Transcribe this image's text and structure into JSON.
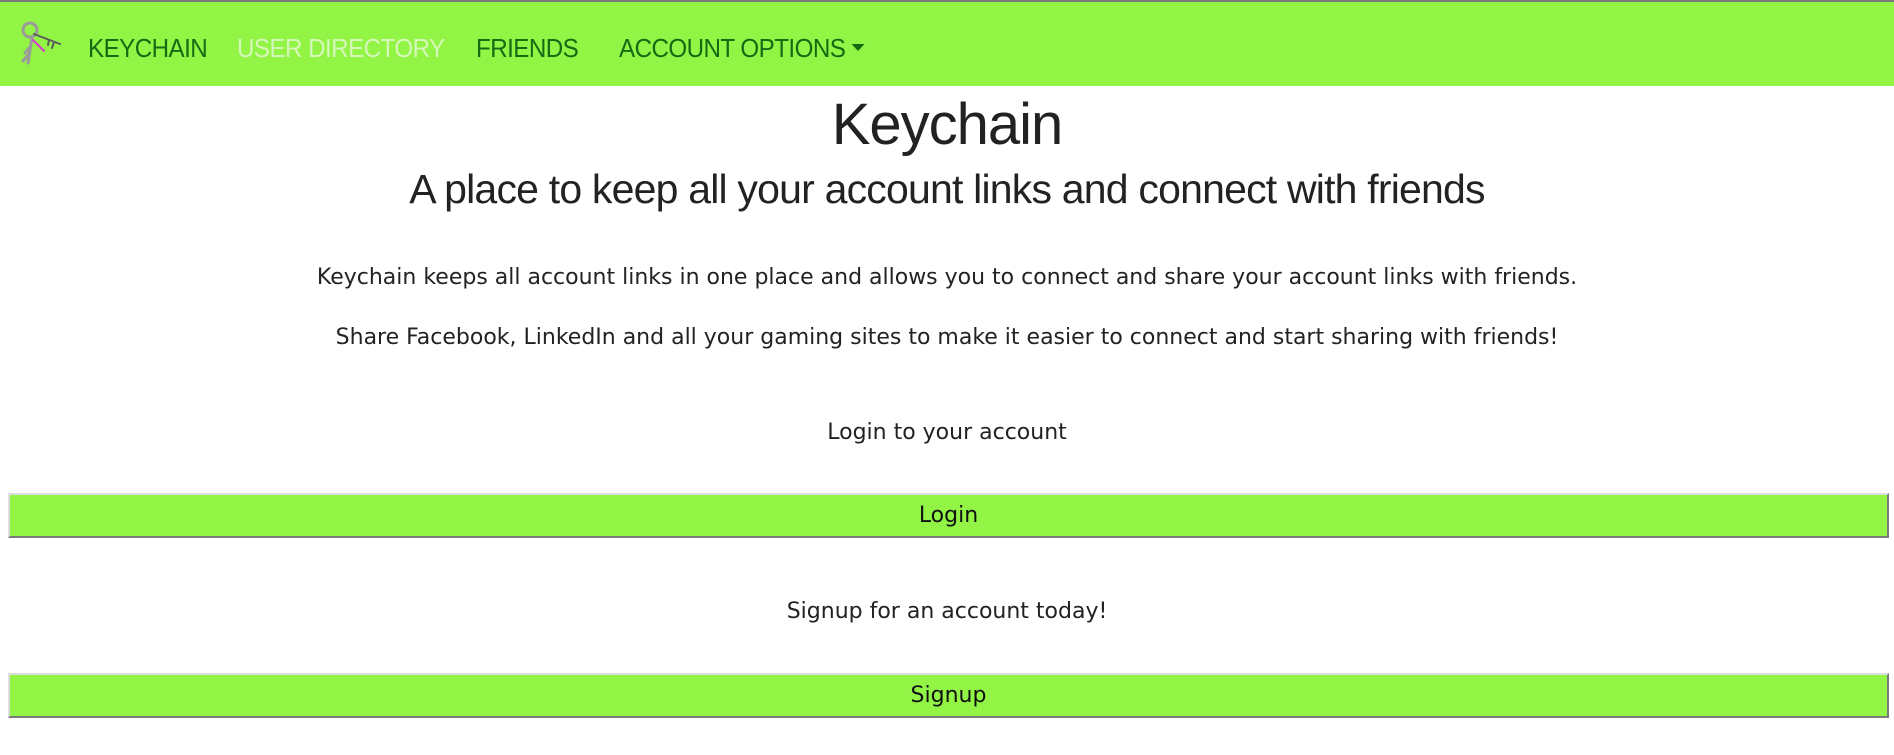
{
  "nav": {
    "brand": "KEYCHAIN",
    "links": [
      "USER DIRECTORY",
      "FRIENDS",
      "ACCOUNT OPTIONS"
    ],
    "logo_icon": "key-icon",
    "dropdown_icon": "caret-down-icon",
    "background_color": "#92f445",
    "link_color": "#146b14",
    "active_link_color": "#d6f7b9"
  },
  "hero": {
    "title": "Keychain",
    "subtitle": "A place to keep all your account links and connect with friends",
    "description": [
      "Keychain keeps all account links in one place and allows you to connect and share your account links with friends.",
      "Share Facebook, LinkedIn and all your gaming sites to make it easier to connect and start sharing with friends!"
    ]
  },
  "auth": {
    "login_prompt": "Login to your account",
    "login_label": "Login",
    "signup_prompt": "Signup for an account today!",
    "signup_label": "Signup",
    "button_color": "#92f445"
  }
}
